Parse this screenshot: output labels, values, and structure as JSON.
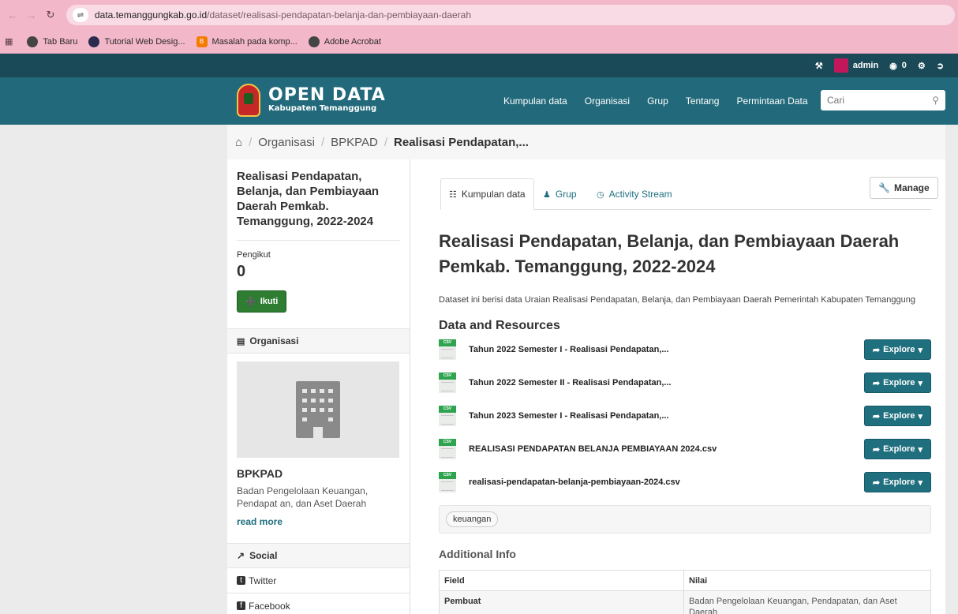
{
  "browser": {
    "url_host": "data.temanggungkab.go.id",
    "url_path": "/dataset/realisasi-pendapatan-belanja-dan-pembiayaan-daerah",
    "bookmarks": [
      {
        "label": "Tab Baru",
        "icon": "globe-icon"
      },
      {
        "label": "Tutorial Web Desig...",
        "icon": "tutorial-icon"
      },
      {
        "label": "Masalah pada komp...",
        "icon": "blogger-icon"
      },
      {
        "label": "Adobe Acrobat",
        "icon": "globe-icon"
      }
    ]
  },
  "account": {
    "username": "admin",
    "activity_count": "0"
  },
  "header": {
    "logo_title": "OPEN DATA",
    "logo_subtitle": "Kabupaten Temanggung",
    "nav": [
      "Kumpulan data",
      "Organisasi",
      "Grup",
      "Tentang",
      "Permintaan Data"
    ],
    "search_placeholder": "Cari"
  },
  "breadcrumb": {
    "items": [
      "Organisasi",
      "BPKPAD"
    ],
    "current": "Realisasi Pendapatan,..."
  },
  "sidebar": {
    "title": "Realisasi Pendapatan, Belanja, dan Pembiayaan Daerah Pemkab. Temanggung, 2022-2024",
    "followers_label": "Pengikut",
    "followers_count": "0",
    "follow_button": "Ikuti",
    "org_section": "Organisasi",
    "org_name": "BPKPAD",
    "org_desc": "Badan Pengelolaan Keuangan, Pendapat an, dan Aset Daerah",
    "read_more": "read more",
    "social_section": "Social",
    "social": [
      "Twitter",
      "Facebook"
    ]
  },
  "main": {
    "tabs": [
      "Kumpulan data",
      "Grup",
      "Activity Stream"
    ],
    "manage_button": "Manage",
    "title": "Realisasi Pendapatan, Belanja, dan Pembiayaan Daerah Pemkab. Temanggung, 2022-2024",
    "description": "Dataset ini berisi data Uraian Realisasi Pendapatan, Belanja, dan Pembiayaan Daerah Pemerintah Kabupaten Temanggung",
    "resources_heading": "Data and Resources",
    "resources": [
      "Tahun 2022 Semester I - Realisasi Pendapatan,...",
      "Tahun 2022 Semester II - Realisasi Pendapatan,...",
      "Tahun 2023 Semester I - Realisasi Pendapatan,...",
      "REALISASI PENDAPATAN BELANJA PEMBIAYAAN 2024.csv",
      "realisasi-pendapatan-belanja-pembiayaan-2024.csv"
    ],
    "explore_label": "Explore",
    "tags": [
      "keuangan"
    ],
    "additional_heading": "Additional Info",
    "table_headers": [
      "Field",
      "Nilai"
    ],
    "table_rows": [
      {
        "field": "Pembuat",
        "value": "Badan Pengelolaan Keuangan, Pendapatan, dan Aset Daerah"
      }
    ]
  }
}
